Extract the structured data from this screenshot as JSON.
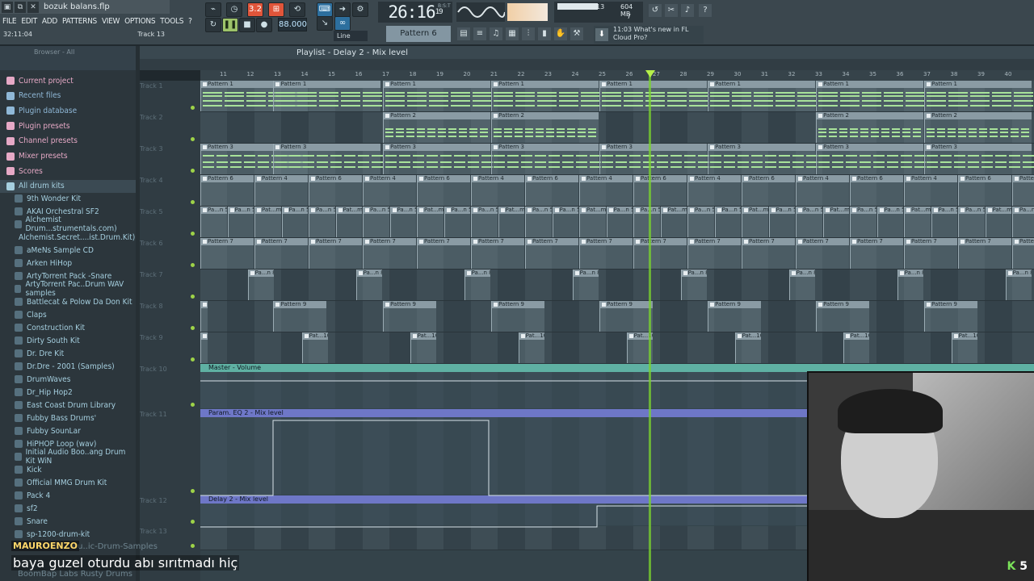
{
  "window": {
    "title": "bozuk balans.flp",
    "buttons": [
      "▣",
      "⧉",
      "✕"
    ]
  },
  "menu": [
    "FILE",
    "EDIT",
    "ADD",
    "PATTERNS",
    "VIEW",
    "OPTIONS",
    "TOOLS",
    "?"
  ],
  "status": {
    "time": "32:11:04",
    "hint": "Track 13"
  },
  "transport": {
    "song_time": "26:16",
    "song_time_frac": "19",
    "song_time_unit": "B:S:T",
    "tempo": "88.000",
    "pattern": "Pattern 6",
    "snap": "Line",
    "mode_label": "3.2"
  },
  "cpu": {
    "value": "13",
    "memory": "604 MB",
    "voices": "7"
  },
  "news": {
    "time": "11:03",
    "line1": "What's new in FL",
    "line2": "Cloud Pro?"
  },
  "browser": {
    "label": "Browser - All",
    "categories": [
      {
        "label": "Current project",
        "color": "#e6a9c6"
      },
      {
        "label": "Recent files",
        "color": "#8fb8d7"
      },
      {
        "label": "Plugin database",
        "color": "#8fb8d7"
      },
      {
        "label": "Plugin presets",
        "color": "#e6a9c6"
      },
      {
        "label": "Channel presets",
        "color": "#e6a9c6"
      },
      {
        "label": "Mixer presets",
        "color": "#e6a9c6"
      },
      {
        "label": "Scores",
        "color": "#e6a9c6"
      },
      {
        "label": "All drum kits",
        "color": "#a5cfdf"
      }
    ],
    "folders": [
      "9th Wonder Kit",
      "AKAI Orchestral SF2",
      "Alchemist Drum...strumentals.com)",
      "Alchemist.Secret....ist.Drum.Kit).WAV",
      "aMeNs Sample CD",
      "Arken HiHop",
      "ArtyTorrent Pack -Snare",
      "ArtyTorrent Pac..Drum WAV samples",
      "Battlecat & Polow Da Don Kit",
      "Claps",
      "Construction Kit",
      "Dirty South Kit",
      "Dr. Dre Kit",
      "Dr.Dre - 2001 (Samples)",
      "DrumWaves",
      "Dr_Hip Hop2",
      "East Coast Drum Library",
      "Fubby  Bass Drums'",
      "Fubby SounLar",
      "HiPHOP Loop (wav)",
      "Initial Audio Boo..ang Drum Kit WiN",
      "Kick",
      "Official MMG Drum Kit",
      "Pack 4",
      "sf2",
      "Snare",
      "sp-1200-drum-kit"
    ]
  },
  "playlist": {
    "title": "Playlist - Delay 2 - Mix level",
    "ruler": [
      "11",
      "12",
      "13",
      "14",
      "15",
      "16",
      "17",
      "18",
      "19",
      "20",
      "21",
      "22",
      "23",
      "24",
      "25",
      "26",
      "27",
      "28",
      "29",
      "30",
      "31",
      "32",
      "33",
      "34",
      "35",
      "36",
      "37",
      "38",
      "39",
      "40"
    ],
    "tracks": [
      "Track 1",
      "Track 2",
      "Track 3",
      "Track 4",
      "Track 5",
      "Track 6",
      "Track 7",
      "Track 8",
      "Track 9",
      "Track 10",
      "Track 11",
      "Track 12",
      "Track 13"
    ],
    "clip_labels": {
      "p1": "Pattern 1",
      "p2": "Pattern 2",
      "p3": "Pattern 3",
      "p4": "Pattern 4",
      "p5": "Pa...n 5",
      "p5b": "Pat...m",
      "p6": "Pattern 6",
      "p7": "Pattern 7",
      "p8": "Pa...n 8",
      "p9": "Pattern 9",
      "p10": "Pat...10"
    },
    "automation": [
      "Master - Volume",
      "Param. EQ 2 - Mix level",
      "Delay 2 - Mix level"
    ]
  },
  "stream": {
    "chat_name": "MAUROENZO",
    "chat_message": "baya guzel oturdu abı sırıtmadı hiç",
    "ghost_1": "ou..ic-Drum-Samples",
    "ghost_2": "BoomBap Labs Rusty Drums",
    "logo_k": "K",
    "logo_num": "5"
  },
  "colors": {
    "accent_green": "#7ad32d",
    "playhead": "#b6f04a",
    "clip_header": "#8a9ba4",
    "automation_green": "#5fb1a3",
    "automation_blue": "#6e77c7"
  }
}
